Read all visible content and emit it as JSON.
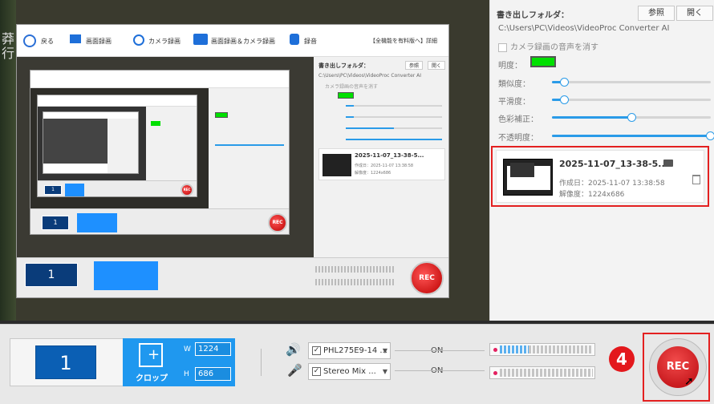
{
  "nested_toolbar": {
    "back": "戻る",
    "screen_rec": "画面録画",
    "camera_rec": "カメラ録画",
    "screen_camera_rec": "画面録画＆カメラ録画",
    "audio_rec": "録音",
    "notice": "【全機能を有料版へ】詳細"
  },
  "nested_panel": {
    "folder_label": "書き出しフォルダ：",
    "browse": "参照",
    "open": "開く",
    "path": "C:\\Users\\PC\\Videos\\VideoProc Converter AI",
    "camera_mute": "カメラ録画の音声を消す",
    "file_name": "2025-11-07_13-38-5...",
    "created": "作成日：2025-11-07 13:38:58",
    "resolution": "解像度：1224x686"
  },
  "panel": {
    "folder_label": "書き出しフォルダ：",
    "browse_button": "参照",
    "open_button": "開く",
    "path": "C:\\Users\\PC\\Videos\\VideoProc Converter AI",
    "camera_mute_label": "カメラ録画の音声を消す",
    "settings": [
      {
        "label": "明度：",
        "type": "color",
        "color": "#00e000"
      },
      {
        "label": "類似度：",
        "value": 0.12
      },
      {
        "label": "平滑度：",
        "value": 0.12
      },
      {
        "label": "色彩補正：",
        "value": 0.5
      },
      {
        "label": "不透明度：",
        "value": 1.0
      }
    ],
    "recording": {
      "file_name": "2025-11-07_13-38-5...",
      "created": "作成日：2025-11-07 13:38:58",
      "resolution": "解像度：1224x686"
    }
  },
  "bottom": {
    "screen_number": "1",
    "crop_label": "クロップ",
    "width_label": "W",
    "height_label": "H",
    "width": "1224",
    "height": "686",
    "speaker_device": "PHL275E9-14 ...",
    "mic_device": "Stereo Mix ...",
    "speaker_state": "ON",
    "mic_state": "ON",
    "rec_label": "REC",
    "step_badge": "4"
  },
  "colors": {
    "accent_blue": "#1f98ef",
    "rec_red": "#c8101a",
    "highlight_red": "#e32020"
  }
}
